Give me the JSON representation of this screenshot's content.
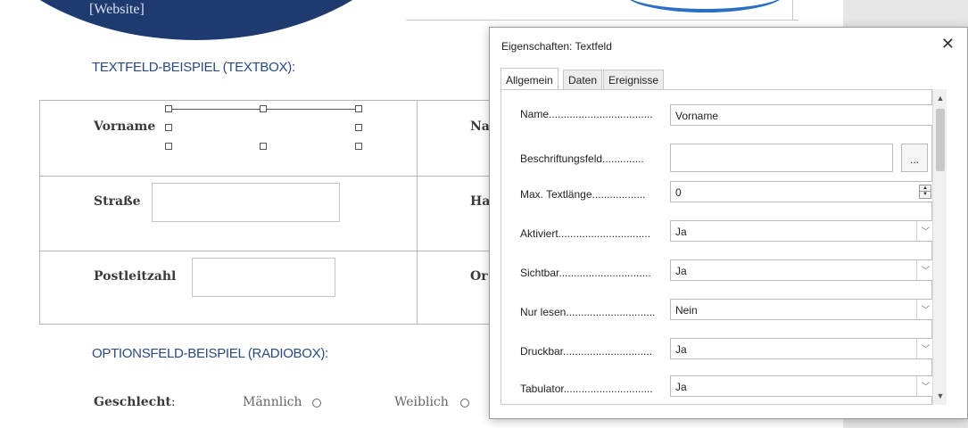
{
  "document": {
    "header_text": "[Website]",
    "textbox_section_title": "TEXTFELD-BEISPIEL (TEXTBOX):",
    "radiobox_section_title": "OPTIONSFELD-BEISPIEL (RADIOBOX):",
    "fields": {
      "vorname": "Vorname",
      "nachname_partial": "Na",
      "strasse": "Straße",
      "hausnummer_partial": "Ha",
      "postleitzahl": "Postleitzahl",
      "ort_partial": "Or"
    },
    "radio": {
      "label": "Geschlecht",
      "colon": ":",
      "option1": "Männlich",
      "option2": "Weiblich"
    }
  },
  "dialog": {
    "title": "Eigenschaften: Textfeld",
    "close_symbol": "✕",
    "tabs": [
      "Allgemein",
      "Daten",
      "Ereignisse"
    ],
    "active_tab": "Allgemein",
    "ellipsis": "...",
    "properties": [
      {
        "label": "Name...................................",
        "value": "Vorname",
        "type": "text"
      },
      {
        "label": "Beschriftungsfeld..............",
        "value": "",
        "type": "text-with-button"
      },
      {
        "label": "Max. Textlänge..................",
        "value": "0",
        "type": "spin"
      },
      {
        "label": "Aktiviert...............................",
        "value": "Ja",
        "type": "dropdown"
      },
      {
        "label": "Sichtbar...............................",
        "value": "Ja",
        "type": "dropdown"
      },
      {
        "label": "Nur lesen..............................",
        "value": "Nein",
        "type": "dropdown"
      },
      {
        "label": "Druckbar..............................",
        "value": "Ja",
        "type": "dropdown"
      },
      {
        "label": "Tabulator..............................",
        "value": "Ja",
        "type": "dropdown"
      }
    ]
  },
  "colors": {
    "header_blue": "#1e3a6e",
    "section_title": "#2a4a7c"
  }
}
